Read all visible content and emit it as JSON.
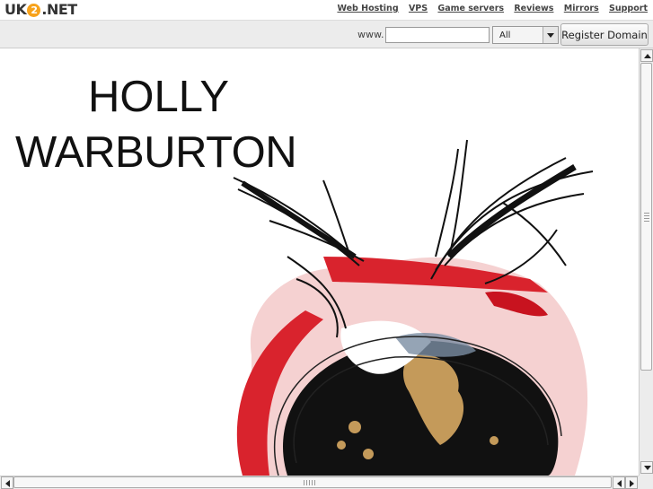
{
  "header": {
    "logo": {
      "part1": "UK",
      "part2": "2",
      "part3": ".NET"
    },
    "nav": [
      "Web Hosting",
      "VPS",
      "Game servers",
      "Reviews",
      "Mirrors",
      "Support"
    ]
  },
  "domain_bar": {
    "prefix": "www.",
    "input_value": "",
    "tld_selected": "All",
    "register_label": "Register Domain"
  },
  "page": {
    "title_line1": "HOLLY",
    "title_line2": "WARBURTON"
  },
  "colors": {
    "accent": "#f7a21b",
    "art_red": "#d9232d",
    "art_black": "#111111",
    "art_gold": "#c49a5a"
  }
}
